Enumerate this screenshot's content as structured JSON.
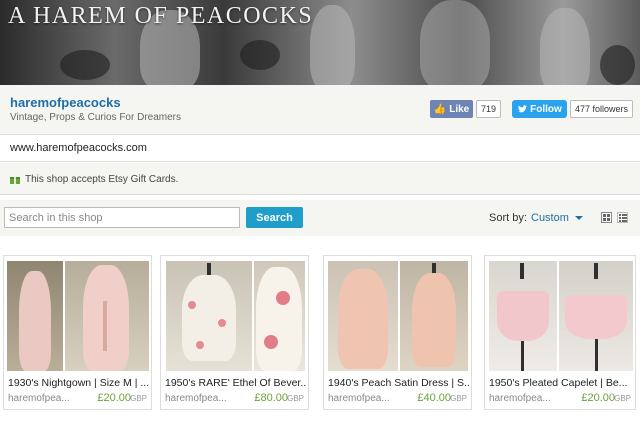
{
  "banner": {
    "title": "A HAREM OF PEACOCKS"
  },
  "shop": {
    "name": "haremofpeacocks",
    "tagline": "Vintage, Props & Curios For Dreamers",
    "like_label": "Like",
    "like_count": "719",
    "follow_label": "Follow",
    "follow_count": "477 followers",
    "url": "www.haremofpeacocks.com",
    "gift_text": "This shop accepts Etsy Gift Cards."
  },
  "search": {
    "placeholder": "Search in this shop",
    "button_label": "Search"
  },
  "sort": {
    "label": "Sort by:",
    "value": "Custom"
  },
  "listings": [
    {
      "title": "1930's Nightgown | Size M | ...",
      "shop": "haremofpea...",
      "price": "£20.00",
      "currency": "GBP"
    },
    {
      "title": "1950's RARE' Ethel Of Bever...",
      "shop": "haremofpea...",
      "price": "£80.00",
      "currency": "GBP"
    },
    {
      "title": "1940's Peach Satin Dress | S...",
      "shop": "haremofpea...",
      "price": "£40.00",
      "currency": "GBP"
    },
    {
      "title": "1950's Pleated Capelet | Be...",
      "shop": "haremofpea...",
      "price": "£20.00",
      "currency": "GBP"
    }
  ],
  "colors": {
    "accent_blue": "#1f6fa8",
    "search_button": "#1f9ec9",
    "price_green": "#69a33b",
    "facebook": "#6d84b4",
    "twitter": "#2aa3ef"
  }
}
